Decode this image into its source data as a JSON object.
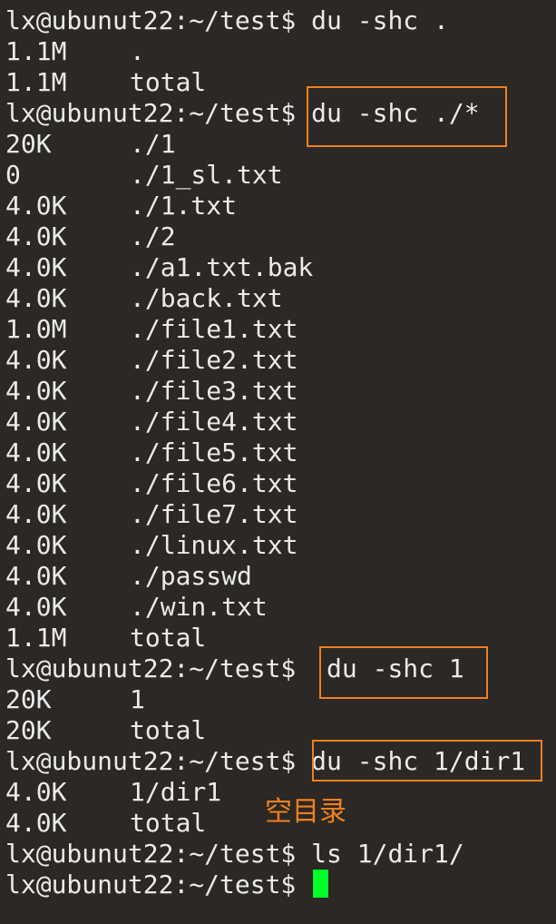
{
  "prompt": "lx@ubunut22:~/test$",
  "commands": {
    "c1": " du -shc .",
    "c2": " du -shc ./*",
    "c3": "  du -shc 1",
    "c4": " du -shc 1/dir1",
    "c5": " ls 1/dir1/",
    "c6": " "
  },
  "out1": [
    {
      "size": "1.1M",
      "path": "."
    },
    {
      "size": "1.1M",
      "path": "total"
    }
  ],
  "out2": [
    {
      "size": "20K",
      "path": "./1"
    },
    {
      "size": "0",
      "path": "./1_sl.txt"
    },
    {
      "size": "4.0K",
      "path": "./1.txt"
    },
    {
      "size": "4.0K",
      "path": "./2"
    },
    {
      "size": "4.0K",
      "path": "./a1.txt.bak"
    },
    {
      "size": "4.0K",
      "path": "./back.txt"
    },
    {
      "size": "1.0M",
      "path": "./file1.txt"
    },
    {
      "size": "4.0K",
      "path": "./file2.txt"
    },
    {
      "size": "4.0K",
      "path": "./file3.txt"
    },
    {
      "size": "4.0K",
      "path": "./file4.txt"
    },
    {
      "size": "4.0K",
      "path": "./file5.txt"
    },
    {
      "size": "4.0K",
      "path": "./file6.txt"
    },
    {
      "size": "4.0K",
      "path": "./file7.txt"
    },
    {
      "size": "4.0K",
      "path": "./linux.txt"
    },
    {
      "size": "4.0K",
      "path": "./passwd"
    },
    {
      "size": "4.0K",
      "path": "./win.txt"
    },
    {
      "size": "1.1M",
      "path": "total"
    }
  ],
  "out3": [
    {
      "size": "20K",
      "path": "1"
    },
    {
      "size": "20K",
      "path": "total"
    }
  ],
  "out4": [
    {
      "size": "4.0K",
      "path": "1/dir1"
    },
    {
      "size": "4.0K",
      "path": "total"
    }
  ],
  "annotation": "空目录",
  "colors": {
    "background": "#2b2825",
    "text": "#ebebeb",
    "highlight": "#f0801e",
    "cursor": "#00ff2a"
  }
}
